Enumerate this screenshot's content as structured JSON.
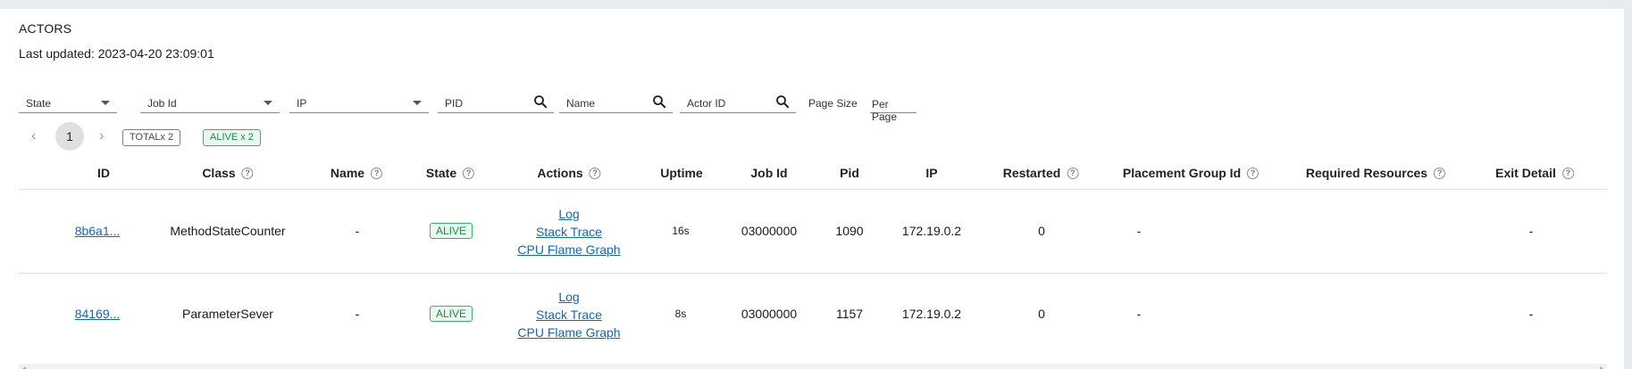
{
  "header": {
    "title": "ACTORS",
    "last_updated": "Last updated: 2023-04-20 23:09:01"
  },
  "filters": {
    "state": "State",
    "job_id": "Job Id",
    "ip": "IP",
    "pid": "PID",
    "name": "Name",
    "actor_id": "Actor ID",
    "page_size": "Page Size",
    "per_page": "Per Page"
  },
  "pagination": {
    "prev": "‹",
    "current": "1",
    "next": "›",
    "total_badge": "TOTALx 2",
    "alive_badge": "ALIVE x 2"
  },
  "columns": {
    "id": "ID",
    "class": "Class",
    "name": "Name",
    "state": "State",
    "actions": "Actions",
    "uptime": "Uptime",
    "job_id": "Job Id",
    "pid": "Pid",
    "ip": "IP",
    "restarted": "Restarted",
    "placement_group_id": "Placement Group Id",
    "required_resources": "Required Resources",
    "exit_detail": "Exit Detail"
  },
  "help_icon": "?",
  "rows": [
    {
      "id": "8b6a1...",
      "class": "MethodStateCounter",
      "name": "-",
      "state": "ALIVE",
      "actions": {
        "log": "Log",
        "stack": "Stack Trace",
        "flame": "CPU Flame Graph"
      },
      "uptime": "16s",
      "job_id": "03000000",
      "pid": "1090",
      "ip": "172.19.0.2",
      "restarted": "0",
      "placement_group_id": "-",
      "required_resources": "",
      "exit_detail": "-"
    },
    {
      "id": "84169...",
      "class": "ParameterSever",
      "name": "-",
      "state": "ALIVE",
      "actions": {
        "log": "Log",
        "stack": "Stack Trace",
        "flame": "CPU Flame Graph"
      },
      "uptime": "8s",
      "job_id": "03000000",
      "pid": "1157",
      "ip": "172.19.0.2",
      "restarted": "0",
      "placement_group_id": "-",
      "required_resources": "",
      "exit_detail": "-"
    }
  ],
  "colors": {
    "link": "#1565c0",
    "alive": "#1a8a47",
    "page_bg": "#e8ecef"
  }
}
